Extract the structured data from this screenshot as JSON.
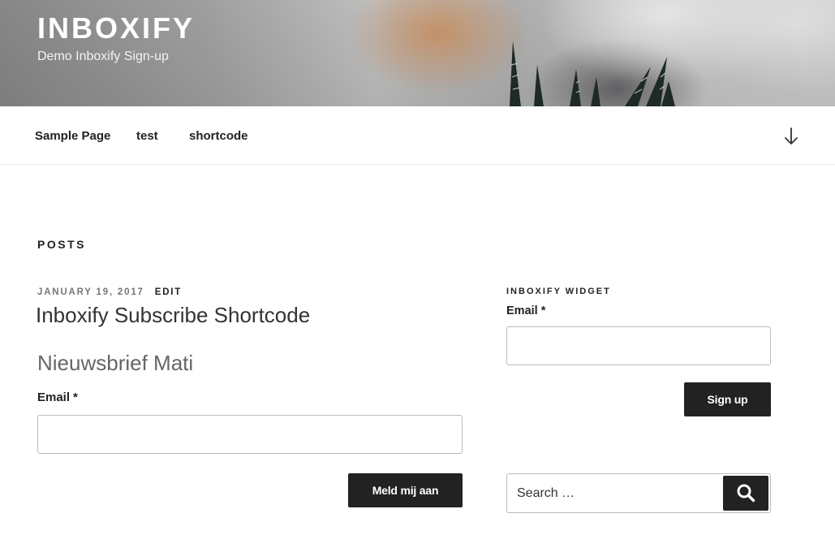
{
  "header": {
    "site_title": "INBOXIFY",
    "site_description": "Demo Inboxify Sign-up"
  },
  "nav": {
    "items": [
      {
        "label": "Sample Page"
      },
      {
        "label": "test"
      },
      {
        "label": "shortcode"
      }
    ],
    "scroll_icon": "arrow-down-icon"
  },
  "main": {
    "page_heading": "Posts",
    "post": {
      "date": "January 19, 2017",
      "edit_label": "Edit",
      "title": "Inboxify Subscribe Shortcode"
    },
    "form": {
      "title": "Nieuwsbrief Mati",
      "email_label": "Email",
      "required_marker": "*",
      "email_value": "",
      "submit_label": "Meld mij aan"
    }
  },
  "sidebar": {
    "widget_title": "Inboxify Widget",
    "email_label": "Email",
    "required_marker": "*",
    "email_value": "",
    "submit_label": "Sign up",
    "search": {
      "placeholder": "Search …",
      "icon": "search-icon"
    }
  },
  "colors": {
    "button_bg": "#222222",
    "text": "#222222",
    "muted": "#767676"
  }
}
